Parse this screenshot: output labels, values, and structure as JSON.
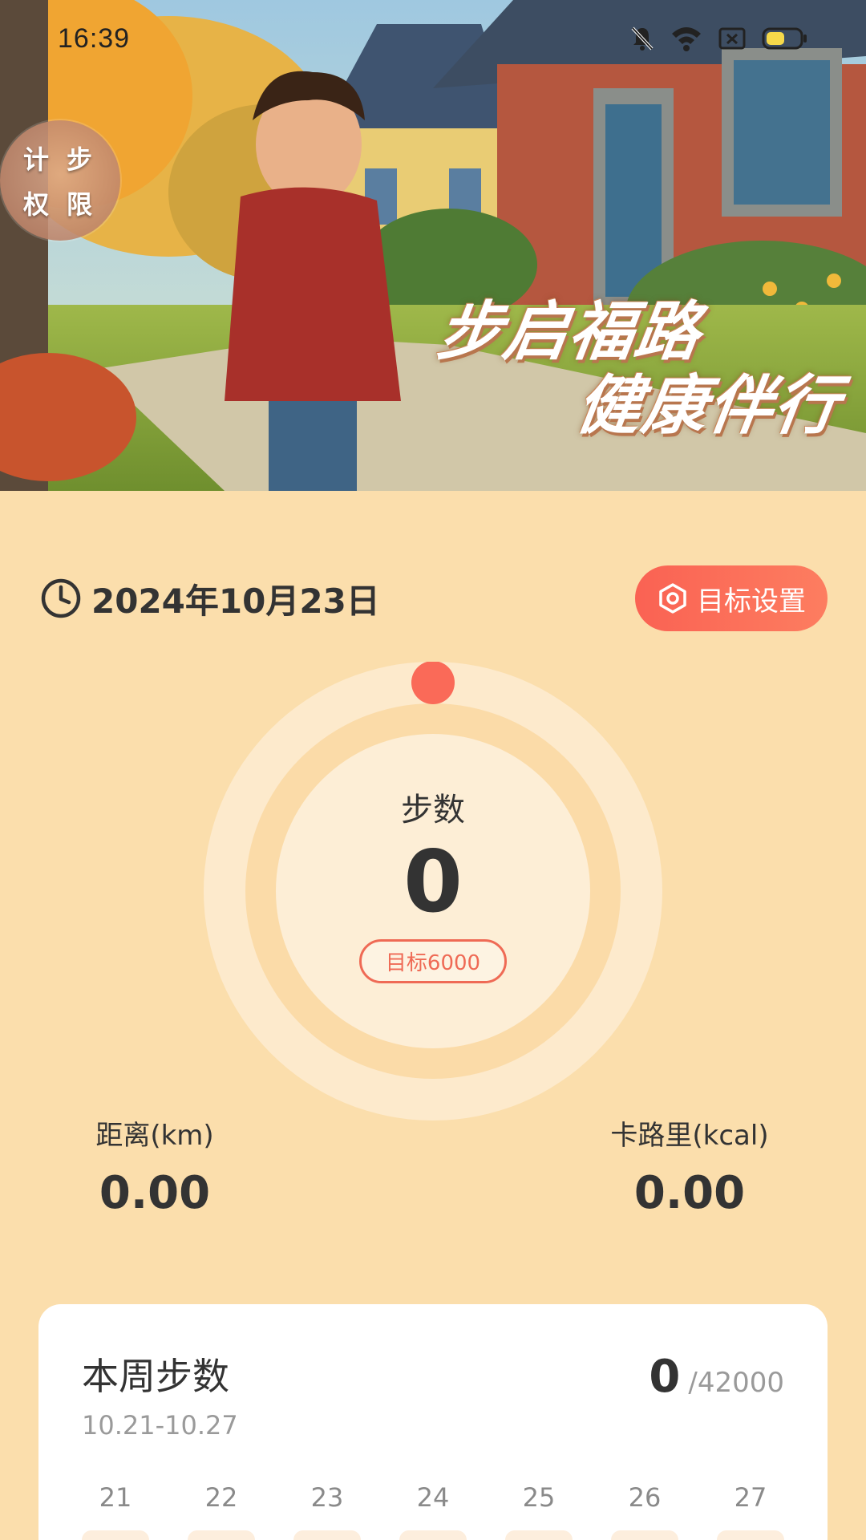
{
  "status_bar": {
    "time": "16:39"
  },
  "hero": {
    "permission_badge": [
      "计",
      "步",
      "权",
      "限"
    ],
    "slogan_line1": "步启福路",
    "slogan_line2": "健康伴行"
  },
  "date_row": {
    "date": "2024年10月23日"
  },
  "goal_button": {
    "label": "目标设置"
  },
  "ring": {
    "label": "步数",
    "steps": "0",
    "goal_label": "目标6000",
    "progress": 0
  },
  "metrics": {
    "distance_label": "距离(km)",
    "distance_value": "0.00",
    "calorie_label": "卡路里(kcal)",
    "calorie_value": "0.00"
  },
  "weekly": {
    "title": "本周步数",
    "range": "10.21-10.27",
    "total": "0",
    "goal": "/42000",
    "days": [
      "21",
      "22",
      "23",
      "24",
      "25",
      "26",
      "27"
    ]
  },
  "colors": {
    "accent": "#fa6253",
    "background": "#fbdeac",
    "ring_outer": "#fdecd4",
    "ring_inner": "#fdefd9"
  }
}
